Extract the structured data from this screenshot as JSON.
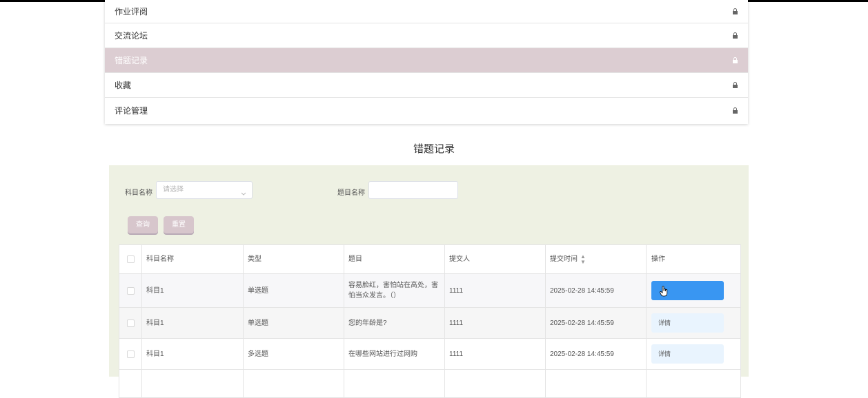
{
  "menu": {
    "items": [
      {
        "label": "作业评阅",
        "active": false
      },
      {
        "label": "交流论坛",
        "active": false
      },
      {
        "label": "错题记录",
        "active": true
      },
      {
        "label": "收藏",
        "active": false
      },
      {
        "label": "评论管理",
        "active": false
      }
    ]
  },
  "page_title": "错题记录",
  "filters": {
    "subject_label": "科目名称",
    "subject_placeholder": "请选择",
    "question_label": "题目名称",
    "question_value": ""
  },
  "buttons": {
    "query": "查询",
    "reset": "重置"
  },
  "table": {
    "headers": [
      "科目名称",
      "类型",
      "题目",
      "提交人",
      "提交时间",
      "操作"
    ],
    "rows": [
      {
        "subject": "科目1",
        "type": "单选题",
        "question": "容易脸红，害怕站在高处，害怕当众发言。（）",
        "submitter": "1111",
        "time": "2025-02-28 14:45:59",
        "action": ""
      },
      {
        "subject": "科目1",
        "type": "单选题",
        "question": "您的年龄是?",
        "submitter": "1111",
        "time": "2025-02-28 14:45:59",
        "action": "详情"
      },
      {
        "subject": "科目1",
        "type": "多选题",
        "question": "在哪些网站进行过网购",
        "submitter": "1111",
        "time": "2025-02-28 14:45:59",
        "action": "详情"
      }
    ]
  },
  "colors": {
    "menu_active_bg": "#dccdd2",
    "panel_bg": "#eef1e3",
    "primary_button": "#3996f2",
    "detail_button_bg": "#e9f4fe"
  }
}
